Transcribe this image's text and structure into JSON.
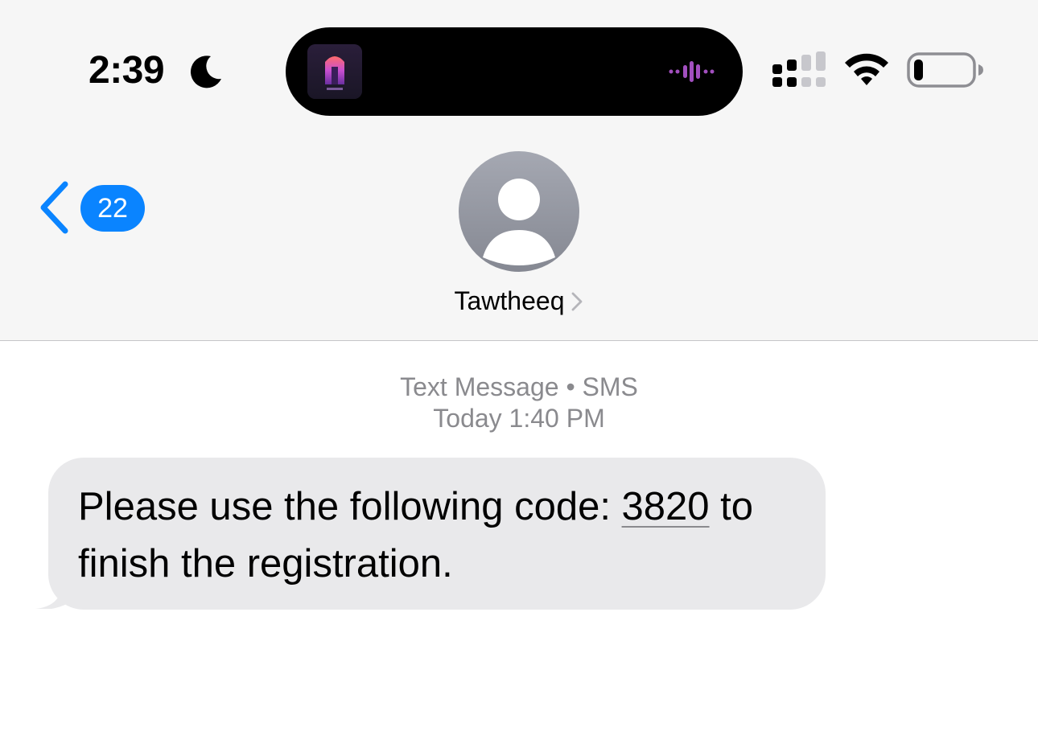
{
  "status_bar": {
    "time": "2:39",
    "focus_icon": "moon-icon",
    "signal_icon": "cellular-signal-icon",
    "wifi_icon": "wifi-icon",
    "battery_icon": "battery-low-icon",
    "battery_level": 0.12
  },
  "dynamic_island": {
    "album_art_icon": "now-playing-artwork",
    "waveform_icon": "audio-waveform-icon",
    "waveform_color": "#a24fbf"
  },
  "nav": {
    "back_icon": "chevron-left-icon",
    "unread_count": "22",
    "accent_color": "#0a84ff"
  },
  "contact": {
    "name": "Tawtheeq",
    "avatar_icon": "person-placeholder-icon"
  },
  "conversation": {
    "service_line": "Text Message • SMS",
    "timestamp": "Today 1:40 PM",
    "messages": [
      {
        "direction": "incoming",
        "text_before": "Please use the following code: ",
        "code": "3820",
        "text_after": " to finish the registration."
      }
    ]
  }
}
